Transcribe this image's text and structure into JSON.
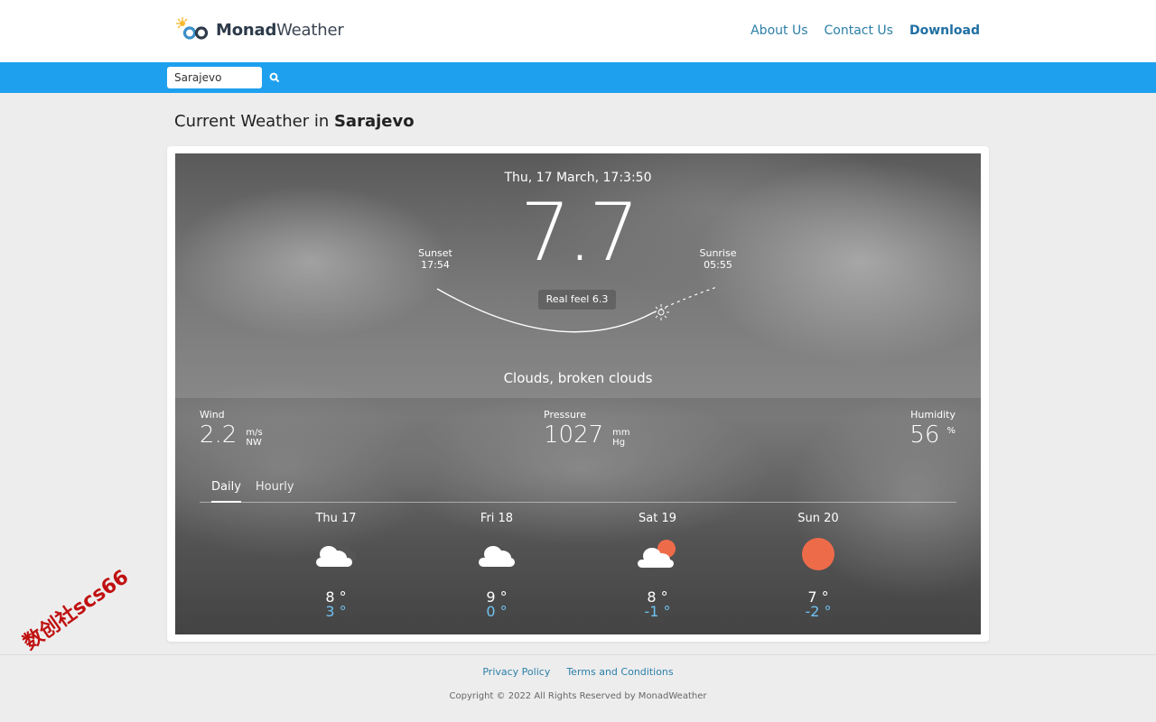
{
  "header": {
    "logo_bold": "Monad",
    "logo_light": "Weather",
    "nav": [
      {
        "label": "About Us"
      },
      {
        "label": "Contact Us"
      },
      {
        "label": "Download"
      }
    ]
  },
  "search": {
    "value": "Sarajevo",
    "icon": "search-icon"
  },
  "title": {
    "prefix": "Current Weather in ",
    "city": "Sarajevo"
  },
  "weather": {
    "datetime": "Thu, 17 March, 17:3:50",
    "temperature": "7.7",
    "sunset_label": "Sunset",
    "sunset_time": "17:54",
    "sunrise_label": "Sunrise",
    "sunrise_time": "05:55",
    "real_feel": "Real feel 6.3",
    "condition": "Clouds, broken clouds",
    "wind": {
      "label": "Wind",
      "value": "2.2",
      "unit": "m/s",
      "direction": "NW"
    },
    "pressure": {
      "label": "Pressure",
      "value": "1027",
      "unit": "mm",
      "unit2": "Hg"
    },
    "humidity": {
      "label": "Humidity",
      "value": "56",
      "unit": "%"
    }
  },
  "tabs": [
    {
      "label": "Daily",
      "active": true
    },
    {
      "label": "Hourly",
      "active": false
    }
  ],
  "forecast": [
    {
      "day": "Thu 17",
      "max": "8 °",
      "min": "3 °",
      "icon": "dark-clouds-icon"
    },
    {
      "day": "Fri 18",
      "max": "9 °",
      "min": "0 °",
      "icon": "cloud-icon"
    },
    {
      "day": "Sat 19",
      "max": "8 °",
      "min": "-1 °",
      "icon": "partly-cloudy-icon"
    },
    {
      "day": "Sun 20",
      "max": "7 °",
      "min": "-2 °",
      "icon": "sun-icon"
    }
  ],
  "footer": {
    "links": [
      {
        "label": "Privacy Policy"
      },
      {
        "label": "Terms and Conditions"
      }
    ],
    "copyright": "Copyright © 2022 All Rights Reserved by MonadWeather"
  },
  "colors": {
    "accent": "#1ea0ef",
    "link": "#2b7fa8",
    "sun": "#ee6b4a",
    "min_temp": "#6fc2f0"
  },
  "watermark": "数创社scs66"
}
